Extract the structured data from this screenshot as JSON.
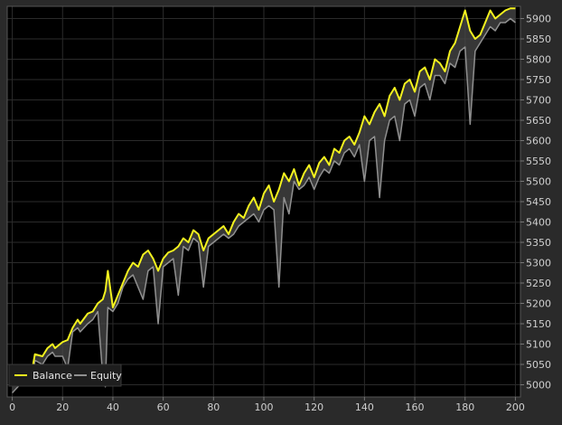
{
  "chart_data": {
    "type": "line",
    "title": "",
    "xlabel": "",
    "ylabel": "",
    "xlim": [
      -2,
      202
    ],
    "ylim": [
      4970,
      5930
    ],
    "x_ticks": [
      0,
      20,
      40,
      60,
      80,
      100,
      120,
      140,
      160,
      180,
      200
    ],
    "y_ticks": [
      5000,
      5050,
      5100,
      5150,
      5200,
      5250,
      5300,
      5350,
      5400,
      5450,
      5500,
      5550,
      5600,
      5650,
      5700,
      5750,
      5800,
      5850,
      5900
    ],
    "y_axis_side": "right",
    "grid": true,
    "legend_position": "bottom-left",
    "series": [
      {
        "name": "Balance",
        "color": "#f4f31e",
        "x": [
          0,
          3,
          5,
          6,
          8,
          9,
          12,
          13,
          14,
          16,
          17,
          20,
          22,
          24,
          26,
          27,
          30,
          32,
          34,
          36,
          37,
          38,
          40,
          42,
          44,
          46,
          48,
          50,
          52,
          54,
          56,
          58,
          60,
          62,
          64,
          66,
          68,
          70,
          72,
          74,
          76,
          78,
          80,
          82,
          84,
          86,
          88,
          90,
          92,
          94,
          96,
          98,
          100,
          102,
          104,
          106,
          108,
          110,
          112,
          114,
          116,
          118,
          120,
          122,
          124,
          126,
          128,
          130,
          132,
          134,
          136,
          138,
          140,
          142,
          144,
          146,
          148,
          150,
          152,
          154,
          156,
          158,
          160,
          162,
          164,
          166,
          168,
          170,
          172,
          174,
          176,
          178,
          180,
          182,
          184,
          186,
          188,
          190,
          192,
          194,
          196,
          198,
          200
        ],
        "values": [
          5000,
          5020,
          5040,
          5030,
          5040,
          5075,
          5070,
          5080,
          5090,
          5100,
          5090,
          5105,
          5110,
          5140,
          5160,
          5150,
          5175,
          5180,
          5200,
          5210,
          5230,
          5280,
          5190,
          5220,
          5250,
          5280,
          5300,
          5290,
          5320,
          5330,
          5310,
          5280,
          5310,
          5325,
          5330,
          5340,
          5360,
          5350,
          5380,
          5370,
          5330,
          5360,
          5370,
          5380,
          5390,
          5370,
          5400,
          5420,
          5410,
          5440,
          5460,
          5430,
          5470,
          5490,
          5450,
          5480,
          5520,
          5500,
          5530,
          5490,
          5520,
          5540,
          5510,
          5545,
          5560,
          5540,
          5580,
          5570,
          5600,
          5610,
          5590,
          5620,
          5660,
          5640,
          5670,
          5690,
          5660,
          5710,
          5730,
          5700,
          5740,
          5750,
          5720,
          5770,
          5780,
          5750,
          5800,
          5790,
          5770,
          5820,
          5840,
          5880,
          5920,
          5870,
          5850,
          5860,
          5890,
          5920,
          5900,
          5910,
          5920,
          5925,
          5925
        ]
      },
      {
        "name": "Equity",
        "color": "#909090",
        "x": [
          0,
          3,
          5,
          6,
          8,
          9,
          12,
          13,
          14,
          16,
          17,
          20,
          22,
          24,
          26,
          27,
          30,
          32,
          34,
          36,
          37,
          38,
          40,
          42,
          44,
          46,
          48,
          50,
          52,
          54,
          56,
          58,
          60,
          62,
          64,
          66,
          68,
          70,
          72,
          74,
          76,
          78,
          80,
          82,
          84,
          86,
          88,
          90,
          92,
          94,
          96,
          98,
          100,
          102,
          104,
          106,
          108,
          110,
          112,
          114,
          116,
          118,
          120,
          122,
          124,
          126,
          128,
          130,
          132,
          134,
          136,
          138,
          140,
          142,
          144,
          146,
          148,
          150,
          152,
          154,
          156,
          158,
          160,
          162,
          164,
          166,
          168,
          170,
          172,
          174,
          176,
          178,
          180,
          182,
          184,
          186,
          188,
          190,
          192,
          194,
          196,
          198,
          200
        ],
        "values": [
          4980,
          5000,
          5020,
          5010,
          5000,
          5060,
          5050,
          5060,
          5070,
          5080,
          5070,
          5070,
          5040,
          5130,
          5140,
          5130,
          5150,
          5160,
          5180,
          5020,
          4995,
          5190,
          5180,
          5200,
          5240,
          5260,
          5270,
          5240,
          5210,
          5280,
          5290,
          5150,
          5290,
          5300,
          5310,
          5220,
          5340,
          5330,
          5360,
          5350,
          5240,
          5340,
          5350,
          5360,
          5370,
          5360,
          5370,
          5390,
          5400,
          5410,
          5420,
          5400,
          5430,
          5440,
          5430,
          5240,
          5460,
          5420,
          5500,
          5480,
          5490,
          5510,
          5480,
          5510,
          5530,
          5520,
          5550,
          5540,
          5570,
          5580,
          5560,
          5590,
          5500,
          5600,
          5610,
          5460,
          5600,
          5650,
          5660,
          5600,
          5690,
          5700,
          5660,
          5730,
          5740,
          5700,
          5760,
          5760,
          5740,
          5790,
          5780,
          5820,
          5830,
          5640,
          5820,
          5840,
          5860,
          5880,
          5870,
          5890,
          5890,
          5900,
          5890
        ]
      }
    ]
  }
}
